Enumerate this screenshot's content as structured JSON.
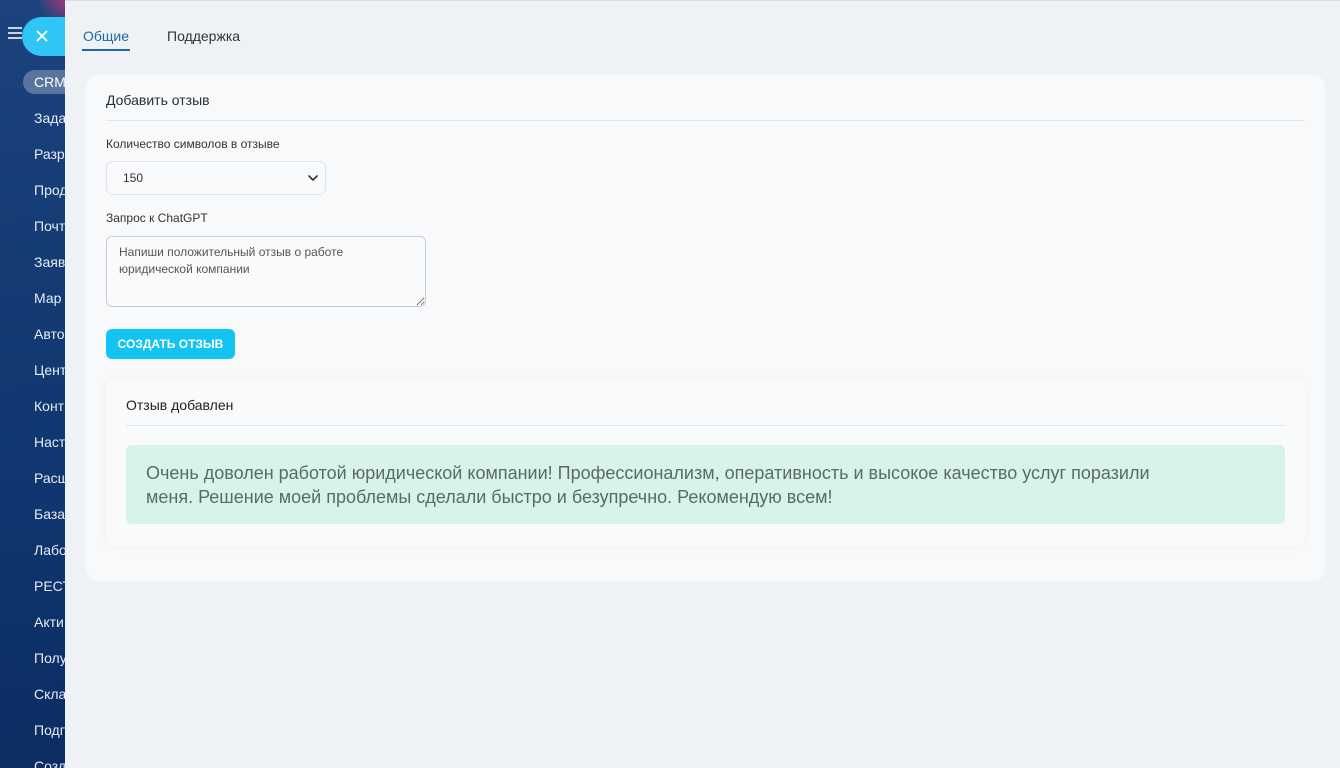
{
  "icons": {
    "menu": "hamburger-icon",
    "close": "close-icon",
    "select": "chevron-down-icon"
  },
  "sidebar": {
    "items": [
      {
        "label": "CRM",
        "active": true
      },
      {
        "label": "Зада"
      },
      {
        "label": "Разр"
      },
      {
        "label": "Прод"
      },
      {
        "label": "Почт"
      },
      {
        "label": "Заяв"
      },
      {
        "label": "Мар"
      },
      {
        "label": "Авто"
      },
      {
        "label": "Цент"
      },
      {
        "label": "Конт"
      },
      {
        "label": "Наст"
      },
      {
        "label": "Расш"
      },
      {
        "label": "База"
      },
      {
        "label": "Лабо"
      },
      {
        "label": "РЕСТ"
      },
      {
        "label": "Акти"
      },
      {
        "label": "Полу"
      },
      {
        "label": "Скла"
      },
      {
        "label": "Подп"
      },
      {
        "label": "Созд"
      }
    ]
  },
  "tabs": [
    {
      "label": "Общие",
      "active": true
    },
    {
      "label": "Поддержка",
      "active": false
    }
  ],
  "form": {
    "title": "Добавить отзыв",
    "length_label": "Количество символов в отзыве",
    "length_value": "150",
    "prompt_label": "Запрос к ChatGPT",
    "prompt_value": "Напиши положительный отзыв о работе юридической компании",
    "submit_label": "СОЗДАТЬ ОТЗЫВ"
  },
  "result": {
    "title": "Отзыв добавлен",
    "text": "Очень доволен работой юридической компании! Профессионализм, оперативность и высокое качество услуг поразили меня. Решение моей проблемы сделали быстро и безупречно. Рекомендую всем!"
  },
  "colors": {
    "accent": "#2067b0",
    "primary_button": "#13c3f2",
    "close_button": "#2fc6f6",
    "success_background": "#d8f4e8",
    "sidebar": "#123a72"
  }
}
